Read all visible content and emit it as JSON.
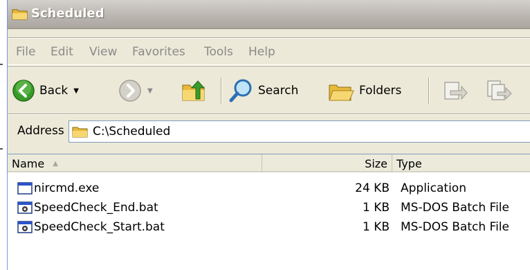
{
  "window": {
    "title": "Scheduled"
  },
  "menu": [
    {
      "label": "File"
    },
    {
      "label": "Edit"
    },
    {
      "label": "View"
    },
    {
      "label": "Favorites"
    },
    {
      "label": "Tools"
    },
    {
      "label": "Help"
    }
  ],
  "toolbar": {
    "back_label": "Back",
    "search_label": "Search",
    "folders_label": "Folders"
  },
  "address": {
    "label": "Address",
    "value": "C:\\Scheduled"
  },
  "columns": {
    "name": "Name",
    "size": "Size",
    "type": "Type"
  },
  "files": [
    {
      "name": "nircmd.exe",
      "size": "24 KB",
      "type": "Application",
      "icon": "application-icon"
    },
    {
      "name": "SpeedCheck_End.bat",
      "size": "1 KB",
      "type": "MS-DOS Batch File",
      "icon": "batch-file-icon"
    },
    {
      "name": "SpeedCheck_Start.bat",
      "size": "1 KB",
      "type": "MS-DOS Batch File",
      "icon": "batch-file-icon"
    }
  ],
  "colors": {
    "back_green": "#3a9a2a",
    "folder_yellow": "#f4c94c",
    "menu_text_disabled": "#8a8a8a"
  }
}
